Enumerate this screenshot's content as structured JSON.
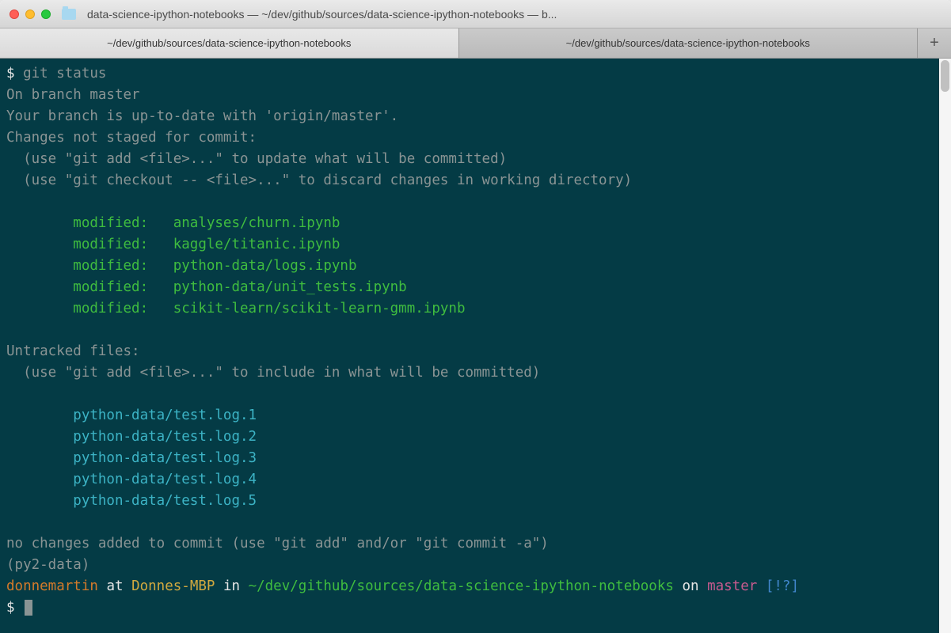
{
  "window": {
    "title": "data-science-ipython-notebooks — ~/dev/github/sources/data-science-ipython-notebooks — b..."
  },
  "tabs": {
    "active": "~/dev/github/sources/data-science-ipython-notebooks",
    "inactive": "~/dev/github/sources/data-science-ipython-notebooks",
    "add_label": "+"
  },
  "terminal": {
    "prompt_symbol": "$",
    "command": "git status",
    "branch_line": "On branch master",
    "uptodate_line": "Your branch is up-to-date with 'origin/master'.",
    "not_staged_header": "Changes not staged for commit:",
    "hint_add": "  (use \"git add <file>...\" to update what will be committed)",
    "hint_checkout": "  (use \"git checkout -- <file>...\" to discard changes in working directory)",
    "modified_label": "modified:",
    "modified_files": [
      "analyses/churn.ipynb",
      "kaggle/titanic.ipynb",
      "python-data/logs.ipynb",
      "python-data/unit_tests.ipynb",
      "scikit-learn/scikit-learn-gmm.ipynb"
    ],
    "untracked_header": "Untracked files:",
    "hint_untracked": "  (use \"git add <file>...\" to include in what will be committed)",
    "untracked_files": [
      "python-data/test.log.1",
      "python-data/test.log.2",
      "python-data/test.log.3",
      "python-data/test.log.4",
      "python-data/test.log.5"
    ],
    "no_changes_line": "no changes added to commit (use \"git add\" and/or \"git commit -a\")",
    "venv": "(py2-data)",
    "ps1": {
      "user": "donnemartin",
      "at": " at ",
      "host": "Donnes-MBP",
      "in": " in ",
      "path": "~/dev/github/sources/data-science-ipython-notebooks",
      "on": " on ",
      "branch": "master",
      "status": " [!?]"
    }
  }
}
